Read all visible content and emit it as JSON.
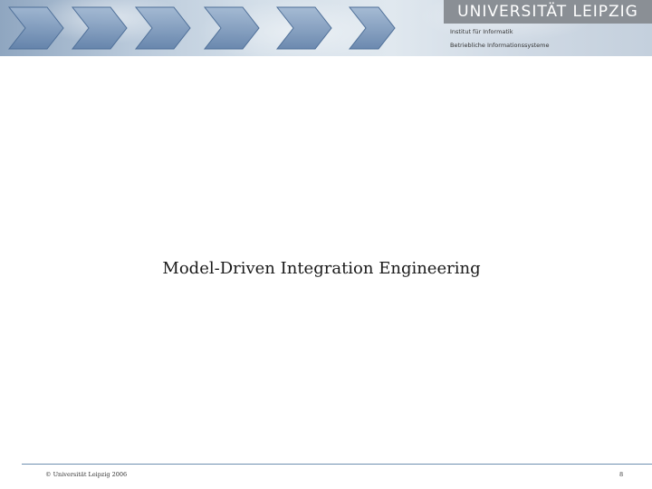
{
  "header": {
    "university": "UNIVERSITÄT LEIPZIG",
    "institute": "Institut für Informatik",
    "department": "Betriebliche Informationssysteme"
  },
  "slide": {
    "title": "Model-Driven Integration Engineering"
  },
  "footer": {
    "copyright": "© Universität Leipzig 2006",
    "page_number": "8"
  },
  "colors": {
    "brand_box": "#8a8f95",
    "chevron": "#6f8fb8",
    "footer_rule": "#6f8fb0"
  }
}
